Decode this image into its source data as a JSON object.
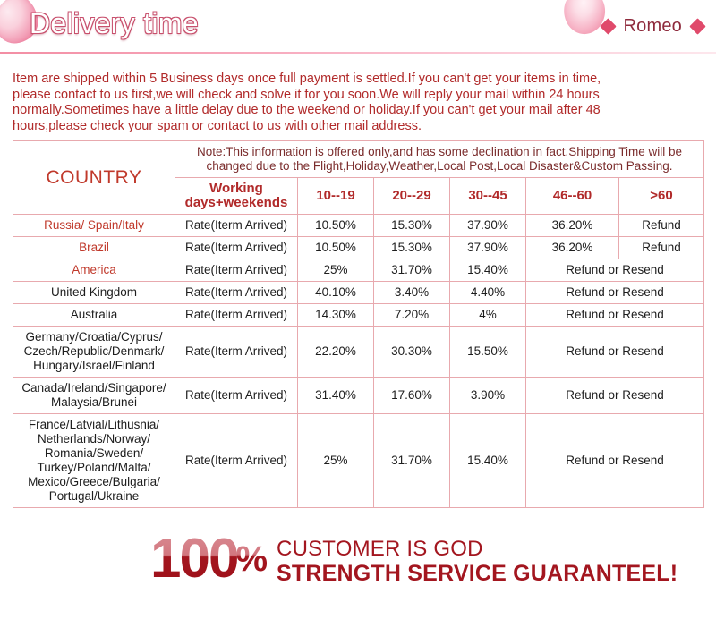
{
  "banner": {
    "title": "Delivery time",
    "brand": "Romeo",
    "left_diamond": "diamond-icon",
    "right_diamond": "diamond-icon"
  },
  "intro": {
    "line1": "Item are shipped within 5 Business days once full payment is settled.If you can't get your items in time,",
    "line2": "please contact to us first,we will check and solve it for you soon.We will reply your mail within 24 hours",
    "line3": "normally.Sometimes have a little delay due to the weekend or holiday.If you can't get your mail after 48",
    "line4": "hours,please check your spam or contact to us with other mail address."
  },
  "table": {
    "country_header": "COUNTRY",
    "note": "Note:This information is offered only,and has some declination in fact.Shipping Time will be changed due to the Flight,Holiday,Weather,Local Post,Local Disaster&Custom Passing.",
    "working_header": "Working days+weekends",
    "ranges": [
      "10--19",
      "20--29",
      "30--45",
      "46--60",
      ">60"
    ],
    "rows": [
      {
        "country": "Russia/ Spain/Italy",
        "country_color": "red",
        "rate_label": "Rate(Iterm Arrived)",
        "v1": "10.50%",
        "v2": "15.30%",
        "v3": "37.90%",
        "v4": "36.20%",
        "v5": "Refund"
      },
      {
        "country": "Brazil",
        "country_color": "red",
        "rate_label": "Rate(Iterm Arrived)",
        "v1": "10.50%",
        "v2": "15.30%",
        "v3": "37.90%",
        "v4": "36.20%",
        "v5": "Refund"
      },
      {
        "country": "America",
        "country_color": "red",
        "rate_label": "Rate(Iterm Arrived)",
        "v1": "25%",
        "v2": "31.70%",
        "v3": "15.40%",
        "merged": "Refund or Resend"
      },
      {
        "country": "United Kingdom",
        "country_color": "black",
        "rate_label": "Rate(Iterm Arrived)",
        "v1": "40.10%",
        "v2": "3.40%",
        "v3": "4.40%",
        "merged": "Refund or Resend"
      },
      {
        "country": "Australia",
        "country_color": "black",
        "rate_label": "Rate(Iterm Arrived)",
        "v1": "14.30%",
        "v2": "7.20%",
        "v3": "4%",
        "merged": "Refund or Resend"
      },
      {
        "country": "Germany/Croatia/Cyprus/\nCzech/Republic/Denmark/\nHungary/Israel/Finland",
        "country_color": "black",
        "rate_label": "Rate(Iterm Arrived)",
        "v1": "22.20%",
        "v2": "30.30%",
        "v3": "15.50%",
        "merged": "Refund or Resend"
      },
      {
        "country": "Canada/Ireland/Singapore/\nMalaysia/Brunei",
        "country_color": "black",
        "rate_label": "Rate(Iterm Arrived)",
        "v1": "31.40%",
        "v2": "17.60%",
        "v3": "3.90%",
        "merged": "Refund or Resend"
      },
      {
        "country": "France/Latvial/Lithusnia/\nNetherlands/Norway/\nRomania/Sweden/\nTurkey/Poland/Malta/\nMexico/Greece/Bulgaria/\nPortugal/Ukraine",
        "country_color": "black",
        "rate_label": "Rate(Iterm Arrived)",
        "v1": "25%",
        "v2": "31.70%",
        "v3": "15.40%",
        "merged": "Refund or Resend"
      }
    ]
  },
  "guarantee": {
    "number": "100",
    "percent": "%",
    "line1": "CUSTOMER IS GOD",
    "line2": "STRENGTH SERVICE GUARANTEEL!"
  },
  "colors": {
    "banner_start": "#ec5f7f",
    "banner_end": "#fad2dd",
    "accent_red": "#b12a2a",
    "country_red": "#c0392b",
    "deep_red": "#a3161f",
    "table_border": "#e8a9ae"
  }
}
